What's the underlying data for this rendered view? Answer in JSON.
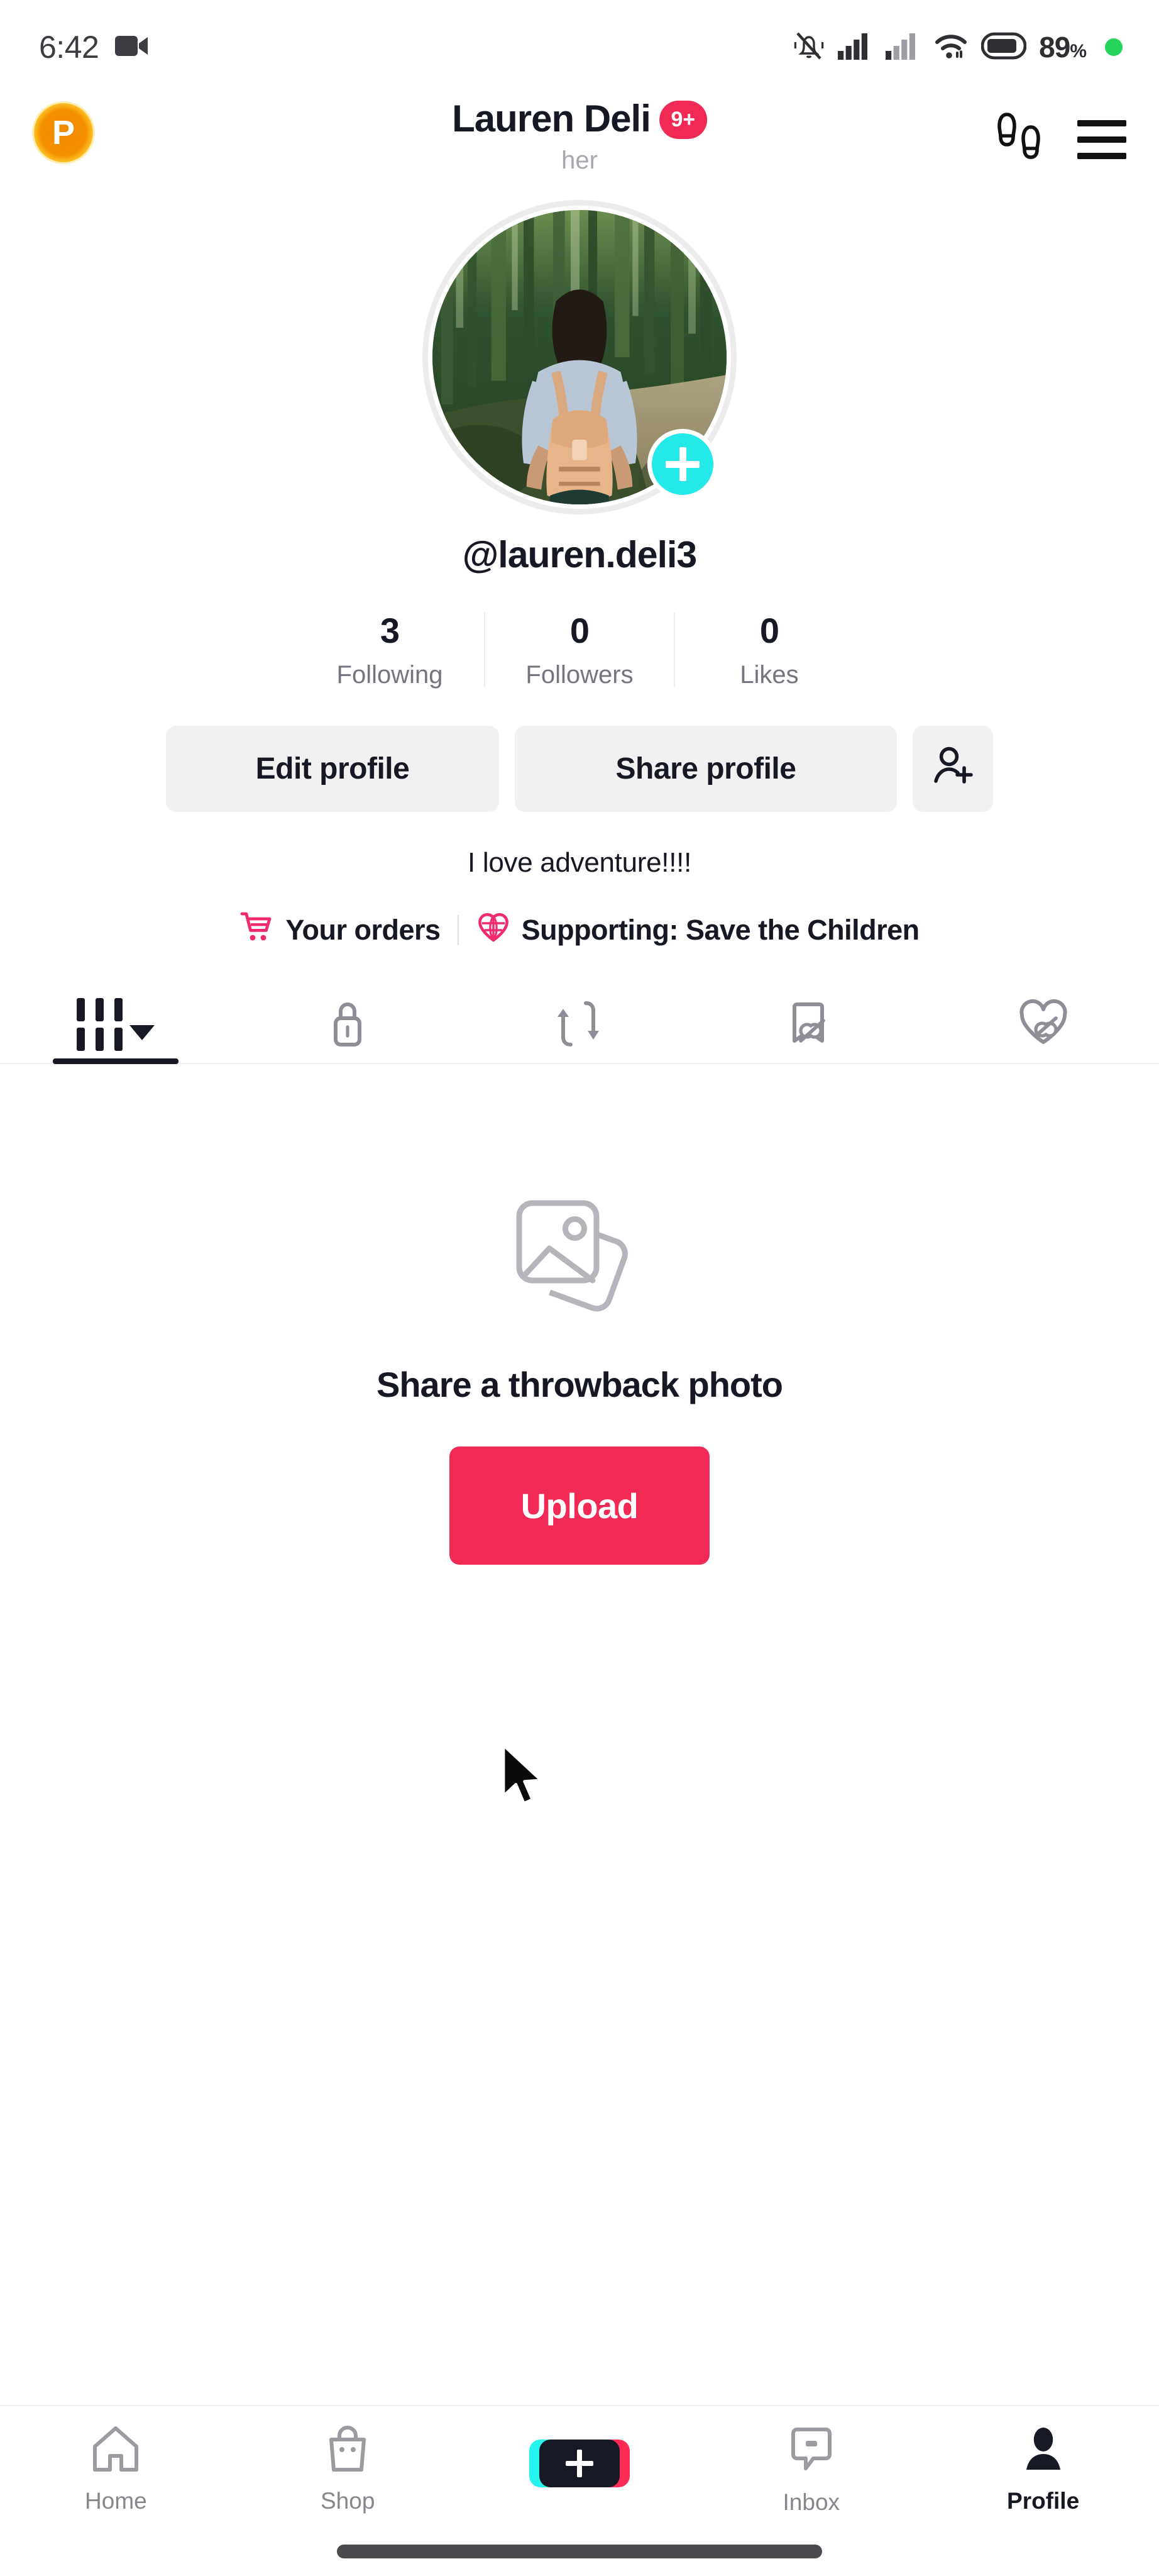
{
  "status_bar": {
    "time": "6:42",
    "screen_record_icon": "video-camera-icon",
    "silent_icon": "bell-muted-icon",
    "signal1_icon": "cellular-signal-icon",
    "signal2_icon": "cellular-signal-secondary-icon",
    "wifi_icon": "wifi-icon",
    "battery_icon": "battery-icon",
    "battery_percent": "89",
    "battery_percent_symbol": "%",
    "indicator_color": "#24d35a"
  },
  "header": {
    "coin_badge_label": "P",
    "display_name": "Lauren Deli",
    "notification_badge": "9+",
    "pronoun": "her",
    "footprints_icon": "footprints-icon",
    "menu_icon": "hamburger-menu-icon"
  },
  "profile": {
    "avatar_alt": "person-with-backpack-in-forest",
    "add_story_icon": "plus-icon",
    "username": "@lauren.deli3",
    "bio": "I love adventure!!!!"
  },
  "stats": [
    {
      "value": "3",
      "label": "Following"
    },
    {
      "value": "0",
      "label": "Followers"
    },
    {
      "value": "0",
      "label": "Likes"
    }
  ],
  "actions": {
    "edit_profile": "Edit profile",
    "share_profile": "Share profile",
    "add_friends_icon": "person-add-icon"
  },
  "meta": {
    "orders_icon": "shopping-cart-icon",
    "orders_label": "Your orders",
    "supporting_icon": "heart-globe-icon",
    "supporting_label": "Supporting: Save the Children"
  },
  "tabs": [
    {
      "icon": "grid-posts-icon",
      "name": "posts",
      "active": true,
      "has_caret": true
    },
    {
      "icon": "lock-private-icon",
      "name": "private",
      "active": false,
      "has_caret": false
    },
    {
      "icon": "repost-icon",
      "name": "reposts",
      "active": false,
      "has_caret": false
    },
    {
      "icon": "bookmark-hidden-icon",
      "name": "favorites",
      "active": false,
      "has_caret": false
    },
    {
      "icon": "heart-hidden-icon",
      "name": "liked",
      "active": false,
      "has_caret": false
    }
  ],
  "empty_state": {
    "icon": "photo-stack-icon",
    "title": "Share a throwback photo",
    "upload_button": "Upload",
    "cursor_icon": "mouse-pointer-icon"
  },
  "bottom_nav": [
    {
      "label": "Home",
      "icon": "home-icon",
      "active": false
    },
    {
      "label": "Shop",
      "icon": "shop-bag-icon",
      "active": false
    },
    {
      "label": "",
      "icon": "create-plus-icon",
      "active": false
    },
    {
      "label": "Inbox",
      "icon": "inbox-icon",
      "active": false
    },
    {
      "label": "Profile",
      "icon": "person-icon",
      "active": true
    }
  ],
  "colors": {
    "accent_pink": "#f02a55",
    "accent_cyan": "#25f4ee",
    "coin_orange": "#f49100",
    "text_primary": "#161823",
    "text_secondary": "#757580",
    "button_grey": "#f1f1f2"
  }
}
